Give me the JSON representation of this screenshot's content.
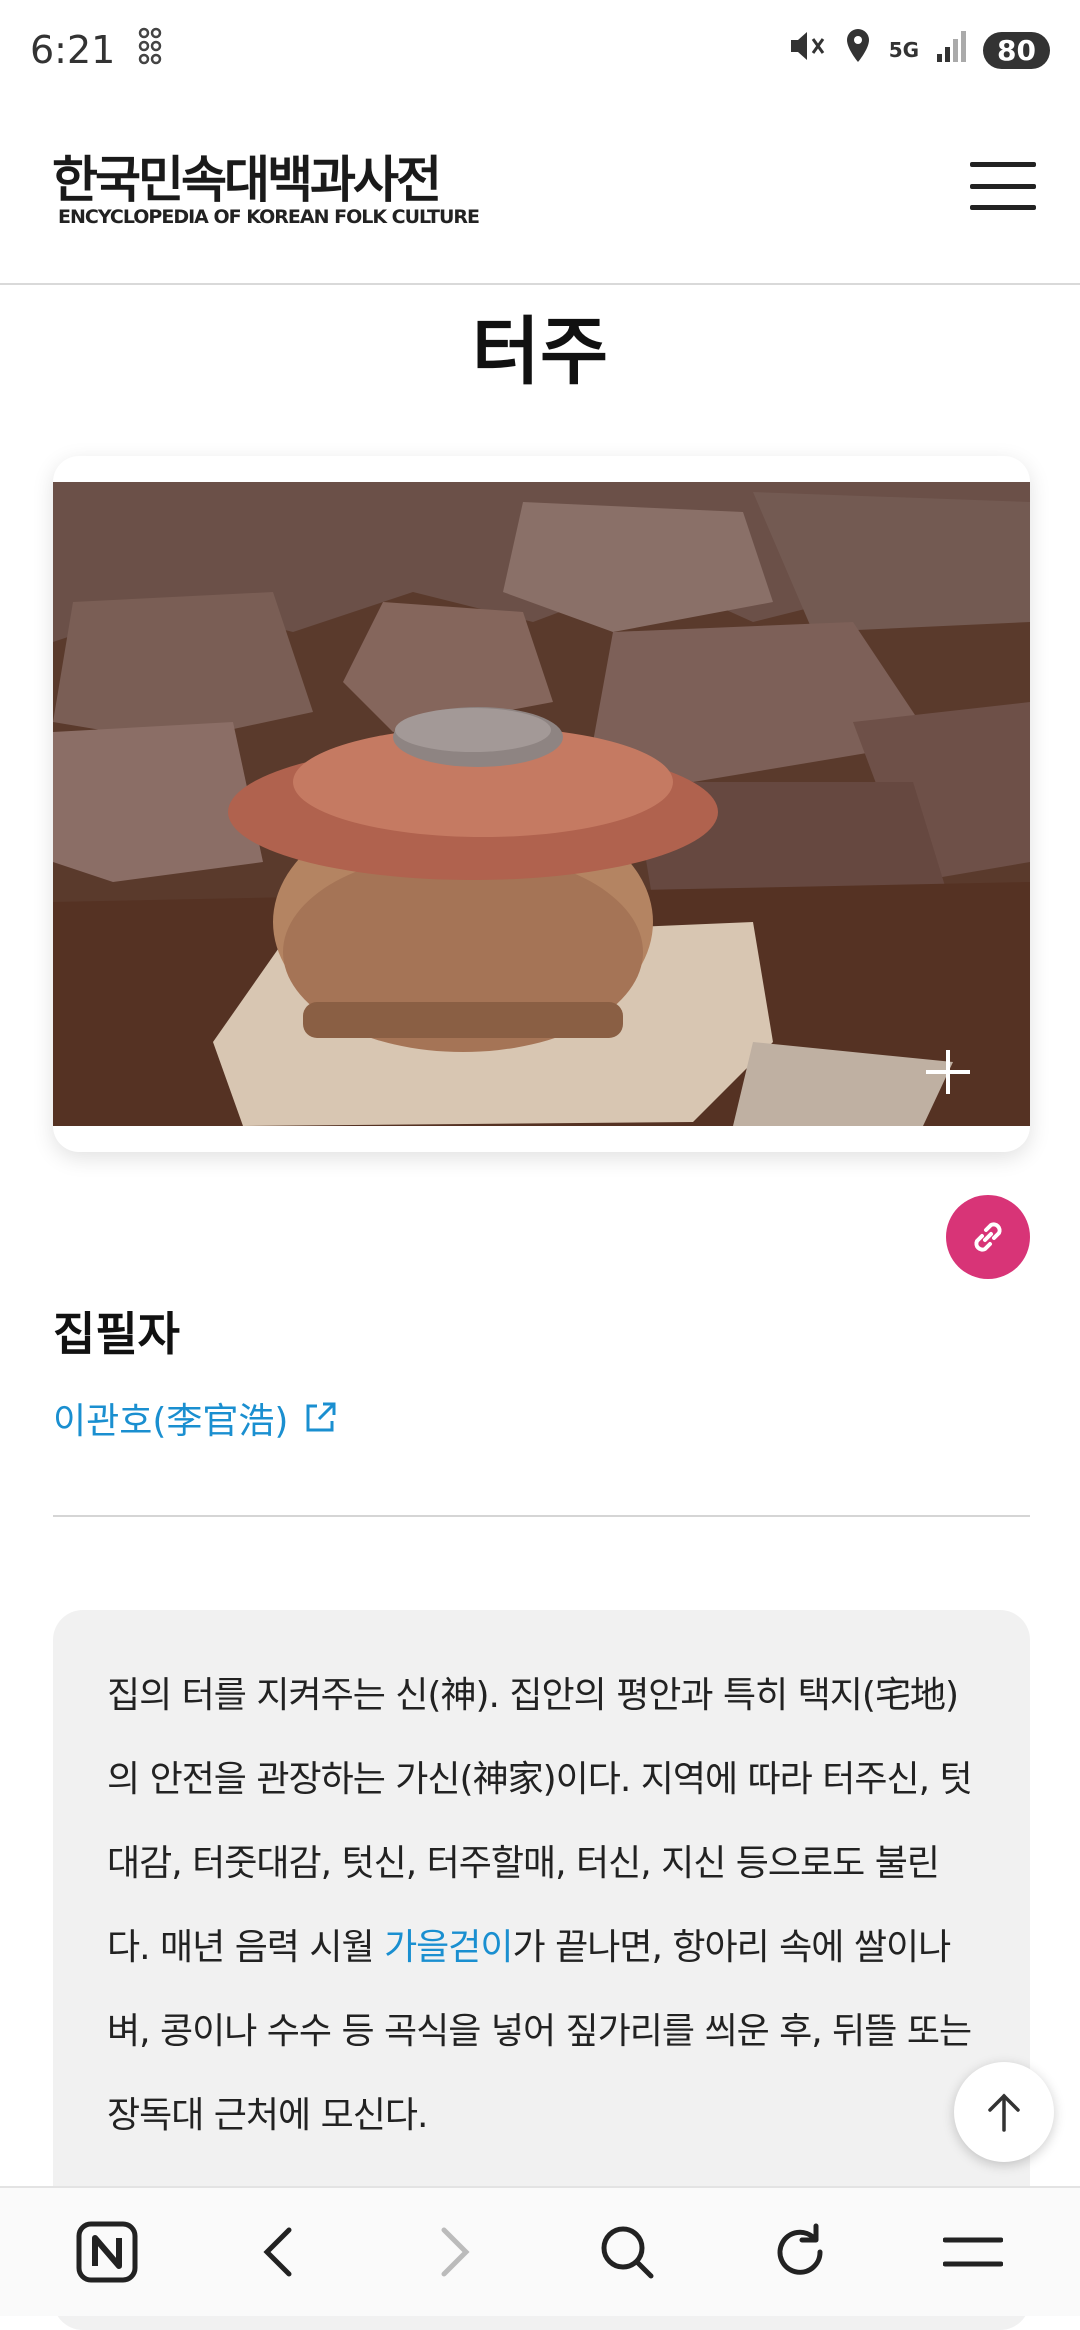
{
  "status_bar": {
    "time": "6:21",
    "network": "5G",
    "battery": "80"
  },
  "header": {
    "logo_ko": "한국민속대백과사전",
    "logo_en": "ENCYCLOPEDIA OF KOREAN FOLK CULTURE"
  },
  "page": {
    "title": "터주"
  },
  "author": {
    "heading": "집필자",
    "name": "이관호(李官浩)"
  },
  "summary": {
    "text_before": "집의 터를 지켜주는 신(神). 집안의 평안과 특히 택지(宅地)의 안전을 관장하는 가신(神家)이다. 지역에 따라 터주신, 텃대감, 터줏대감, 텃신, 터주할매, 터신, 지신 등으로도 불린다. 매년 음력 시월 ",
    "link": "가을걷이",
    "text_after": "가 끝나면, 항아리 속에 쌀이나 벼, 콩이나 수수 등 곡식을 넣어 짚가리를 씌운 후, 뒤뜰 또는 장독대 근처에 모신다."
  },
  "colors": {
    "accent_link": "#1a8fd0",
    "share_button": "#d83477"
  },
  "icons": {
    "menu": "hamburger-icon",
    "expand": "plus-icon",
    "share": "link-icon",
    "external": "external-link-icon",
    "scroll_top": "arrow-up-icon",
    "nav": [
      "naver-icon",
      "back-icon",
      "forward-icon",
      "search-icon",
      "refresh-icon",
      "menu-icon"
    ]
  }
}
